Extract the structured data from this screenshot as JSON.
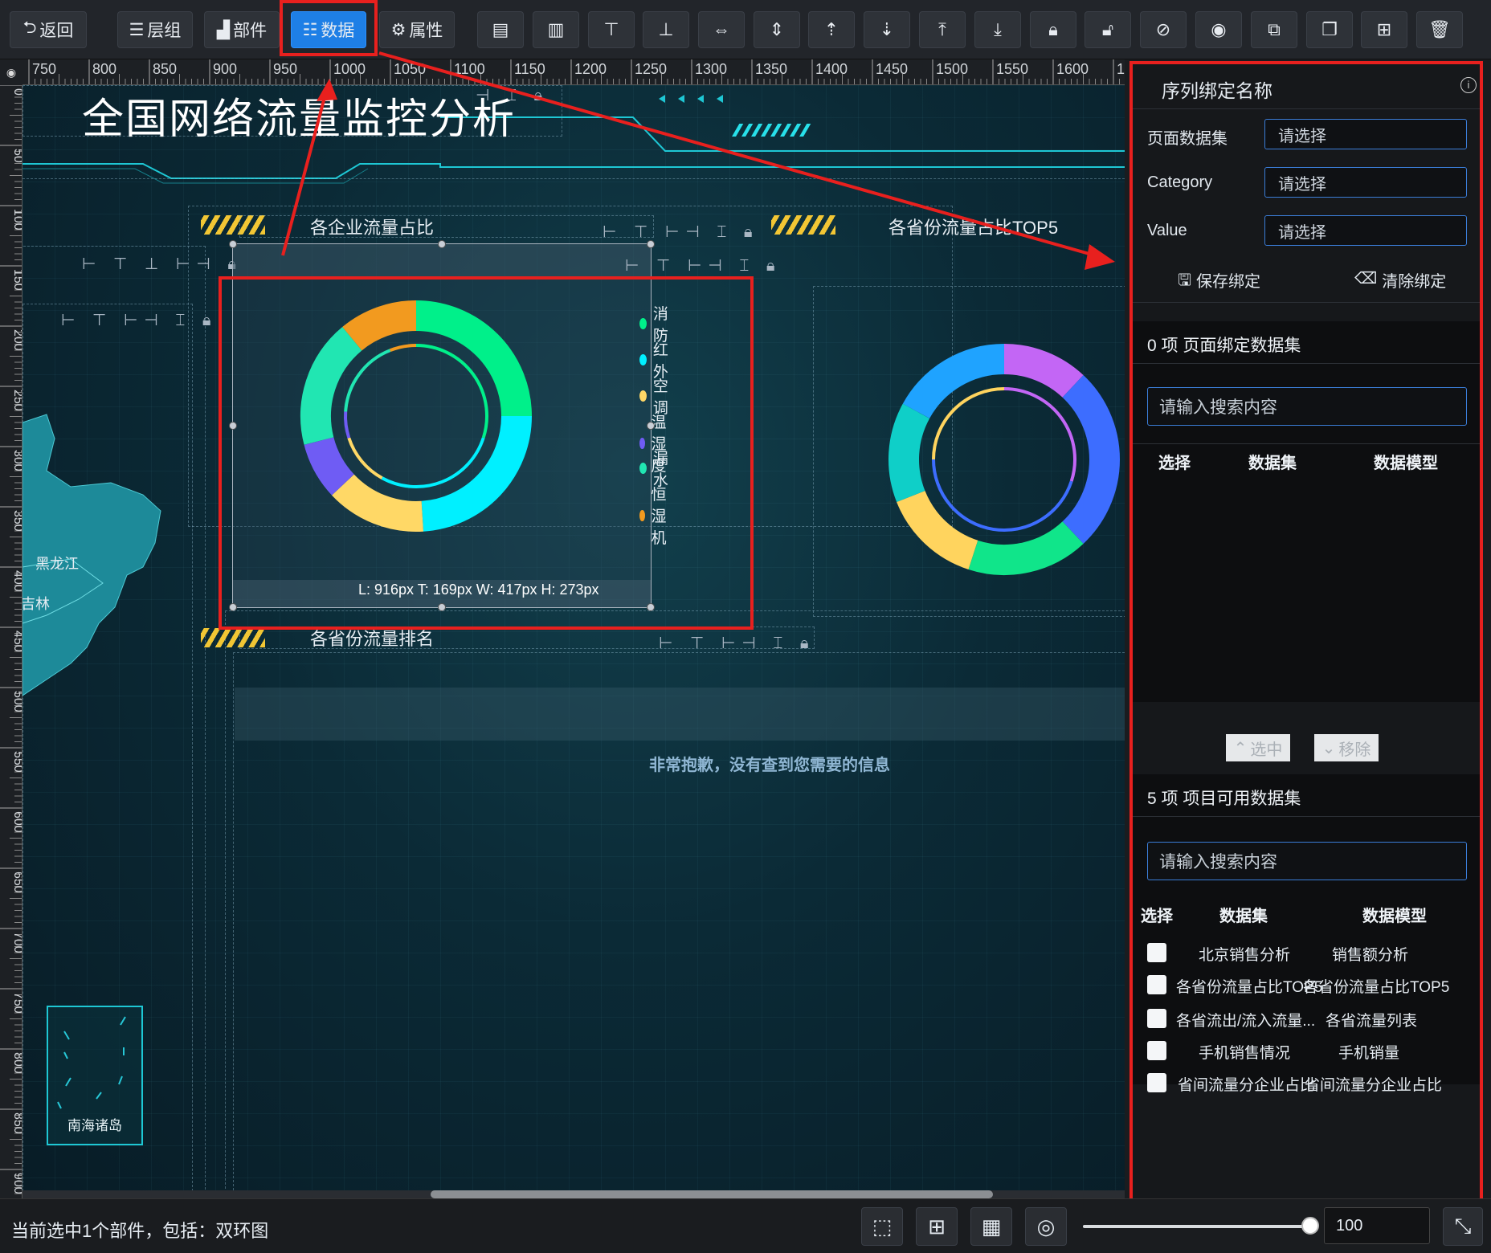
{
  "toolbar": {
    "back": "返回",
    "layers": "层组",
    "widgets": "部件",
    "data": "数据",
    "props": "属性",
    "icons": [
      "align-left-icon",
      "align-right-icon",
      "align-top-icon",
      "align-bottom-icon",
      "distribute-h-icon",
      "distribute-v-icon",
      "layer-up-icon",
      "layer-down-icon",
      "layer-top-icon",
      "layer-bottom-icon",
      "lock-icon",
      "unlock-icon",
      "hide-icon",
      "show-icon",
      "copy-icon",
      "duplicate-icon",
      "add-icon",
      "delete-icon"
    ]
  },
  "ruler": {
    "h_ticks": [
      "750",
      "800",
      "850",
      "900",
      "950",
      "1000",
      "1050",
      "1100",
      "1150",
      "1200",
      "1250",
      "1300",
      "1350",
      "1400",
      "1450",
      "1500",
      "1550",
      "1600",
      "1"
    ],
    "v_ticks": [
      "0",
      "50",
      "100",
      "150",
      "200",
      "250",
      "300",
      "350",
      "400",
      "450",
      "500",
      "550",
      "600",
      "650",
      "700",
      "750",
      "800",
      "850",
      "900"
    ]
  },
  "canvas": {
    "title": "全国网络流量监控分析",
    "map_labels": [
      "黑龙江",
      "吉林"
    ],
    "inset_label": "南海诸岛",
    "panel1_title": "各企业流量占比",
    "panel2_title": "各省份流量占比TOP5",
    "panel3_title": "各省份流量排名",
    "empty_message": "非常抱歉，没有查到您需要的信息",
    "selection_info": "L: 916px T: 169px W: 417px H: 273px"
  },
  "chart_data": [
    {
      "type": "pie",
      "subtype": "double-ring",
      "title": "各企业流量占比",
      "legend_position": "right",
      "outer": {
        "labels": [
          "消防",
          "红外",
          "空调",
          "温湿度",
          "漏水",
          "恒湿机"
        ],
        "values": [
          25,
          24,
          14,
          8,
          18,
          11
        ],
        "colors": [
          "#00f08a",
          "#00f0ff",
          "#ffd866",
          "#6f5cf4",
          "#21e6b2",
          "#f29a1f"
        ]
      },
      "inner": {
        "labels": [
          "消防",
          "红外",
          "空调",
          "温湿度",
          "漏水",
          "恒湿机"
        ],
        "values": [
          30,
          28,
          12,
          6,
          18,
          6
        ],
        "colors": [
          "#00f08a",
          "#00f0ff",
          "#ffd866",
          "#6f5cf4",
          "#21e6b2",
          "#f29a1f"
        ]
      }
    },
    {
      "type": "pie",
      "subtype": "double-ring",
      "title": "各省份流量占比TOP5",
      "outer": {
        "values": [
          12,
          26,
          17,
          14,
          14,
          17
        ],
        "colors": [
          "#c366f5",
          "#3d6dff",
          "#10e58a",
          "#ffd45e",
          "#0fcfc8",
          "#1fa3ff"
        ]
      },
      "inner": {
        "values": [
          30,
          45,
          25
        ],
        "colors": [
          "#c366f5",
          "#3d6dff",
          "#ffd45e"
        ]
      }
    }
  ],
  "panel": {
    "title": "序列绑定名称",
    "info_icon": "info-icon",
    "dataset_label": "页面数据集",
    "category_label": "Category",
    "value_label": "Value",
    "placeholder": "请选择",
    "save_binding": "保存绑定",
    "clear_binding": "清除绑定",
    "page_bound_title": "0 项 页面绑定数据集",
    "search_placeholder": "请输入搜索内容",
    "col_select": "选择",
    "col_dataset": "数据集",
    "col_model": "数据模型",
    "select_btn": "选中",
    "remove_btn": "移除",
    "available_title": "5 项 项目可用数据集",
    "rows": [
      {
        "dataset": "北京销售分析",
        "model": "销售额分析"
      },
      {
        "dataset": "各省份流量占比TOP5",
        "model": "各省份流量占比TOP5"
      },
      {
        "dataset": "各省流出/流入流量...",
        "model": "各省流量列表"
      },
      {
        "dataset": "手机销售情况",
        "model": "手机销量"
      },
      {
        "dataset": "省间流量分企业占比",
        "model": "省间流量分企业占比"
      }
    ]
  },
  "status": {
    "selection": "当前选中1个部件，包括：双环图",
    "zoom": "100"
  }
}
